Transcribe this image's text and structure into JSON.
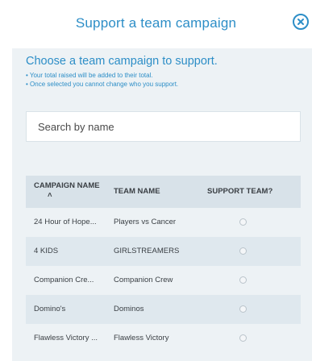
{
  "header": {
    "title": "Support a team campaign",
    "close_icon": "close-circle-icon"
  },
  "intro": {
    "heading": "Choose a team campaign to support.",
    "notes": [
      "• Your total raised will be added to their total.",
      "• Once selected you cannot change who you support."
    ]
  },
  "search": {
    "placeholder": "Search by name",
    "value": ""
  },
  "table": {
    "columns": {
      "campaign": "CAMPAIGN NAME",
      "sort_indicator": "˄",
      "team": "TEAM NAME",
      "support": "SUPPORT TEAM?"
    },
    "rows": [
      {
        "campaign": "24 Hour of Hope...",
        "team": "Players vs Cancer",
        "selected": false
      },
      {
        "campaign": "4 KIDS",
        "team": "GIRLSTREAMERS",
        "selected": false
      },
      {
        "campaign": "Companion Cre...",
        "team": "Companion Crew",
        "selected": false
      },
      {
        "campaign": "Domino's",
        "team": "Dominos",
        "selected": false
      },
      {
        "campaign": "Flawless Victory ...",
        "team": "Flawless Victory",
        "selected": false
      }
    ]
  },
  "colors": {
    "accent": "#2d8ec7",
    "panel": "#edf2f5",
    "header_row": "#d8e2e9",
    "alt_row": "#dfe8ee"
  }
}
